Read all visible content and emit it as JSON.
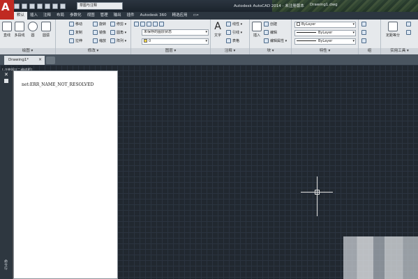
{
  "app": {
    "logo_letter": "A",
    "workspace": "草图与注释",
    "title": "Autodesk AutoCAD 2014 - 未注册版本",
    "file": "Drawing1.dwg"
  },
  "ribbon_tabs": [
    "默认",
    "插入",
    "注释",
    "布局",
    "参数化",
    "视图",
    "管理",
    "输出",
    "插件",
    "Autodesk 360",
    "精选应用",
    "▭•"
  ],
  "panels": {
    "draw": {
      "label": "绘图 ▾",
      "line": "直线",
      "polyline": "多段线",
      "circle": "圆",
      "arc": "圆弧"
    },
    "modify": {
      "label": "修改 ▾",
      "move": "移动",
      "rotate": "旋转",
      "trim": "修剪 ▾",
      "copy": "复制",
      "mirror": "镜像",
      "fillet": "圆角 ▾",
      "stretch": "拉伸",
      "scale": "缩放",
      "array": "阵列 ▾"
    },
    "layers": {
      "label": "图层 ▾",
      "state": "未保存的图层状态",
      "current": "0"
    },
    "annotation": {
      "label": "注释 ▾",
      "text": "文字",
      "linear": "线性 ▾",
      "leader": "引线 ▾",
      "table": "表格"
    },
    "block": {
      "label": "块 ▾",
      "insert": "插入",
      "create": "创建",
      "edit": "编辑",
      "edit_attr": "编辑属性 ▾"
    },
    "properties": {
      "label": "特性 ▾",
      "color": "ByLayer",
      "linetype": "ByLayer",
      "lineweight": "ByLayer"
    },
    "groups": {
      "label": "组"
    },
    "utilities": {
      "label": "实用工具 ▾",
      "measure": "定距等分"
    }
  },
  "document": {
    "tab": "Drawing1*",
    "viewport_label": "[-][俯视][二维线框]"
  },
  "palette": {
    "close": "✕",
    "side_label": "命令行",
    "content": "net:ERR_NAME_NOT_RESOLVED"
  }
}
